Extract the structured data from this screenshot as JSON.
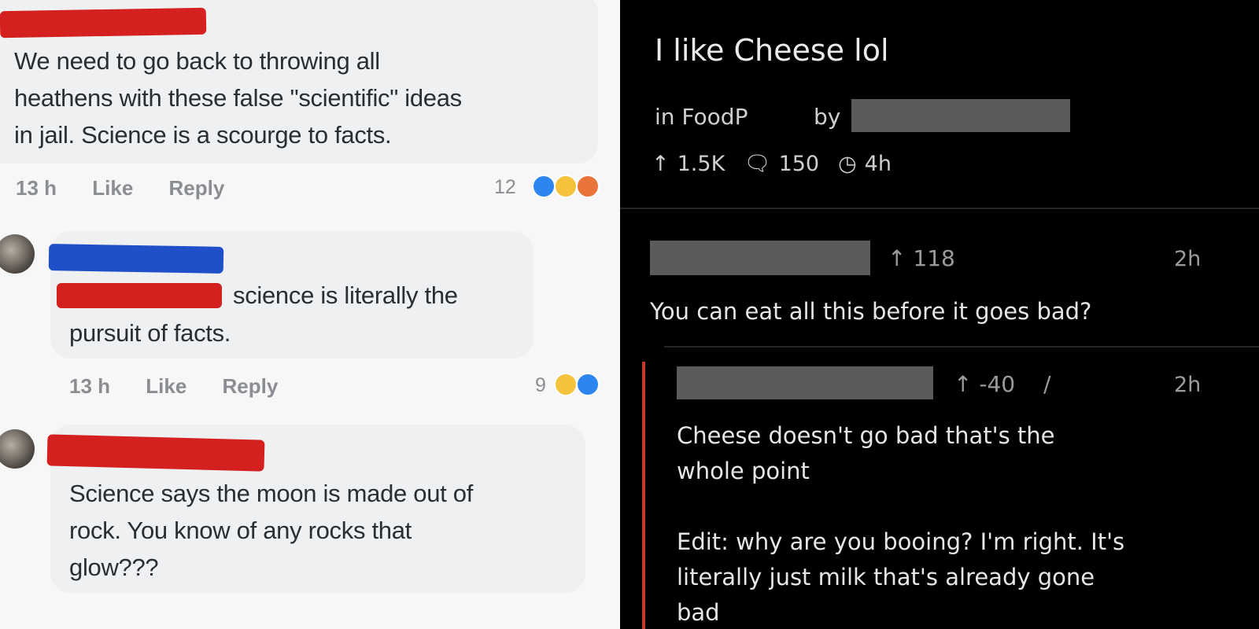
{
  "left": {
    "comments": [
      {
        "lines": [
          "We need to go back to throwing all",
          "heathens with these false \"scientific\" ideas",
          "in jail. Science is a scourge to facts."
        ],
        "time": "13 h",
        "like": "Like",
        "reply": "Reply",
        "reactions": "12"
      },
      {
        "line1": "science is literally the",
        "line2": "pursuit of facts.",
        "time": "13 h",
        "like": "Like",
        "reply": "Reply",
        "reactions": "9"
      },
      {
        "lines": [
          "Science says the moon is made out of",
          "rock. You know of any rocks that",
          "glow???"
        ]
      }
    ],
    "colors": {
      "redact_red": "#d4201e",
      "redact_blue": "#1f4fc9"
    }
  },
  "right": {
    "post": {
      "title": "I like Cheese lol",
      "in": "in FoodP",
      "by": "by",
      "upvotes": "1.5K",
      "comments": "150",
      "age": "4h",
      "icons": [
        "up-arrow-icon",
        "comment-bubble-icon",
        "clock-icon"
      ]
    },
    "comments": [
      {
        "score": "118",
        "time": "2h",
        "text": "You can eat all this before it goes bad?"
      },
      {
        "score": "-40",
        "time": "2h",
        "edited": "pencil-icon",
        "lines": [
          "Cheese doesn't go bad that's the",
          "whole point",
          "",
          "Edit: why are you booing? I'm right. It's",
          "literally just milk that's already gone",
          "bad"
        ]
      }
    ],
    "colors": {
      "thread_line": "#c0392b"
    }
  }
}
